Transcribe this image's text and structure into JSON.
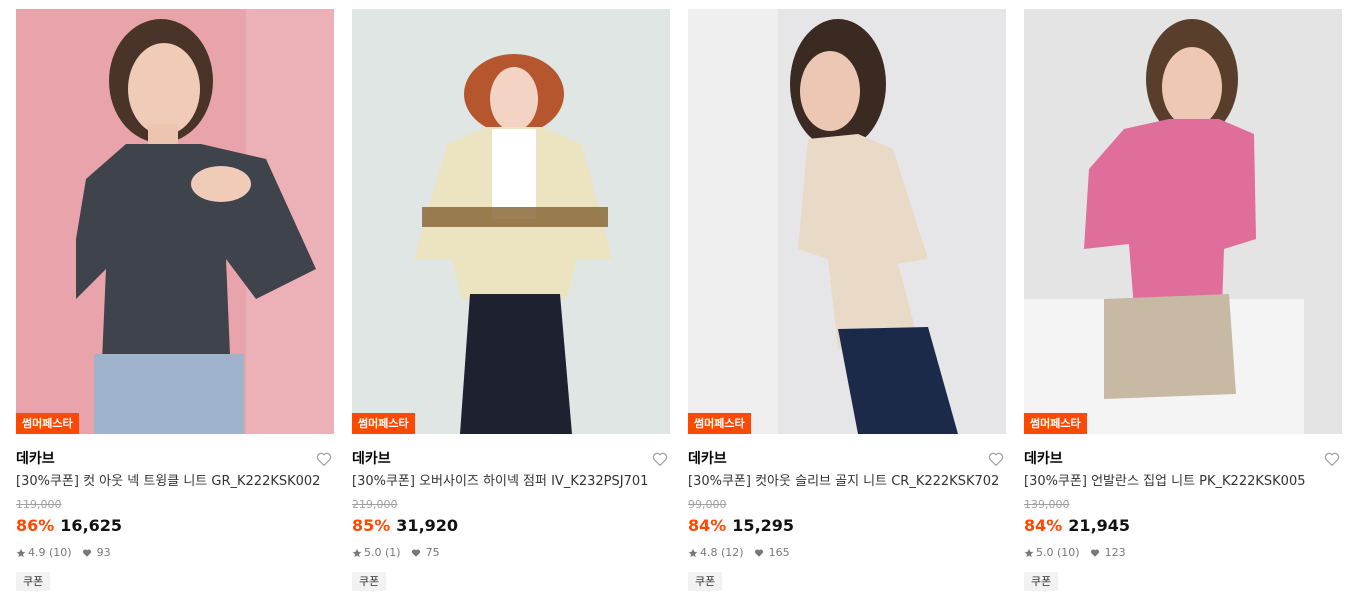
{
  "products": [
    {
      "badge": "썸머페스타",
      "brand": "데카브",
      "title": "[30%쿠폰] 컷 아웃 넥 트윙클 니트 GR_K222KSK002",
      "original_price": "119,000",
      "discount": "86%",
      "sale_price": "16,625",
      "rating": "4.9",
      "reviews": "(10)",
      "likes": "93",
      "tag": "쿠폰",
      "colors": {
        "bg": "#e9a3ab",
        "garment": "#3f434b",
        "bottom": "#9fb4cc",
        "hair": "#4a3429"
      }
    },
    {
      "badge": "썸머페스타",
      "brand": "데카브",
      "title": "[30%쿠폰] 오버사이즈 하이넥 점퍼 IV_K232PSJ701",
      "original_price": "219,000",
      "discount": "85%",
      "sale_price": "31,920",
      "rating": "5.0",
      "reviews": "(1)",
      "likes": "75",
      "tag": "쿠폰",
      "colors": {
        "bg": "#dfe6e4",
        "garment": "#ece4c0",
        "bottom": "#1e2230",
        "hair": "#b5562e"
      }
    },
    {
      "badge": "썸머페스타",
      "brand": "데카브",
      "title": "[30%쿠폰] 컷아웃 슬리브 골지 니트 CR_K222KSK702",
      "original_price": "99,000",
      "discount": "84%",
      "sale_price": "15,295",
      "rating": "4.8",
      "reviews": "(12)",
      "likes": "165",
      "tag": "쿠폰",
      "colors": {
        "bg": "#e6e6e8",
        "garment": "#e9dac8",
        "bottom": "#1c2a4a",
        "hair": "#3b2a22"
      }
    },
    {
      "badge": "썸머페스타",
      "brand": "데카브",
      "title": "[30%쿠폰] 언발란스 집업 니트 PK_K222KSK005",
      "original_price": "139,000",
      "discount": "84%",
      "sale_price": "21,945",
      "rating": "5.0",
      "reviews": "(10)",
      "likes": "123",
      "tag": "쿠폰",
      "colors": {
        "bg": "#e4e4e4",
        "garment": "#e06e9a",
        "bottom": "#c7b9a3",
        "hair": "#5a3e2c"
      }
    }
  ]
}
